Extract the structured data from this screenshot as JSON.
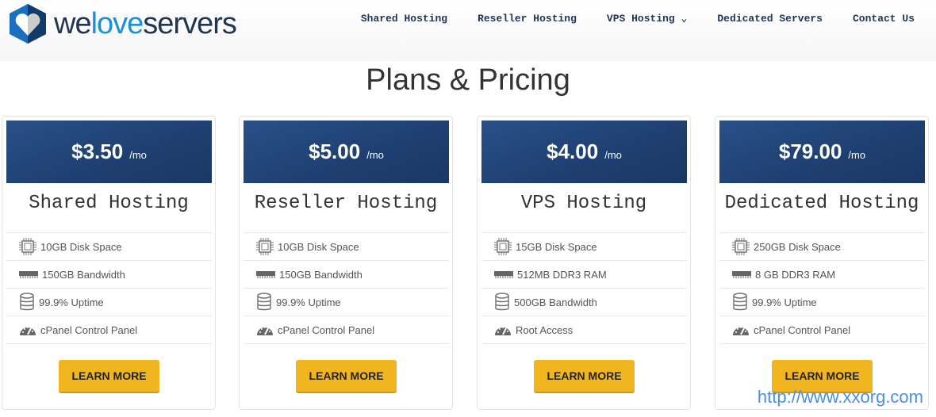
{
  "brand": {
    "pre": "we",
    "mid": "love",
    "post": "servers"
  },
  "nav": [
    "Shared Hosting",
    "Reseller Hosting",
    "VPS Hosting ⌄",
    "Dedicated Servers",
    "Contact Us"
  ],
  "title": "Plans & Pricing",
  "plans": [
    {
      "price": "$3.50",
      "per": "/mo",
      "name": "Shared Hosting",
      "features": [
        {
          "icon": "chip",
          "text": "10GB Disk Space"
        },
        {
          "icon": "ram",
          "text": "150GB Bandwidth"
        },
        {
          "icon": "database",
          "text": "99.9% Uptime"
        },
        {
          "icon": "gauge",
          "text": "cPanel Control Panel"
        }
      ],
      "button": "LEARN MORE"
    },
    {
      "price": "$5.00",
      "per": "/mo",
      "name": "Reseller Hosting",
      "features": [
        {
          "icon": "chip",
          "text": "10GB Disk Space"
        },
        {
          "icon": "ram",
          "text": "150GB Bandwidth"
        },
        {
          "icon": "database",
          "text": "99.9% Uptime"
        },
        {
          "icon": "gauge",
          "text": "cPanel Control Panel"
        }
      ],
      "button": "LEARN MORE"
    },
    {
      "price": "$4.00",
      "per": "/mo",
      "name": "VPS Hosting",
      "features": [
        {
          "icon": "chip",
          "text": "15GB Disk Space"
        },
        {
          "icon": "ram",
          "text": "512MB DDR3 RAM"
        },
        {
          "icon": "database",
          "text": "500GB Bandwidth"
        },
        {
          "icon": "gauge",
          "text": "Root Access"
        }
      ],
      "button": "LEARN MORE"
    },
    {
      "price": "$79.00",
      "per": "/mo",
      "name": "Dedicated Hosting",
      "features": [
        {
          "icon": "chip",
          "text": "250GB Disk Space"
        },
        {
          "icon": "ram",
          "text": "8 GB DDR3 RAM"
        },
        {
          "icon": "database",
          "text": "99.9% Uptime"
        },
        {
          "icon": "gauge",
          "text": "cPanel Control Panel"
        }
      ],
      "button": "LEARN MORE"
    }
  ],
  "watermark": "http://www.xxorg.com",
  "colors": {
    "band": "#1e3f70",
    "button": "#f0b51f",
    "brand_blue": "#1b8fd9"
  }
}
